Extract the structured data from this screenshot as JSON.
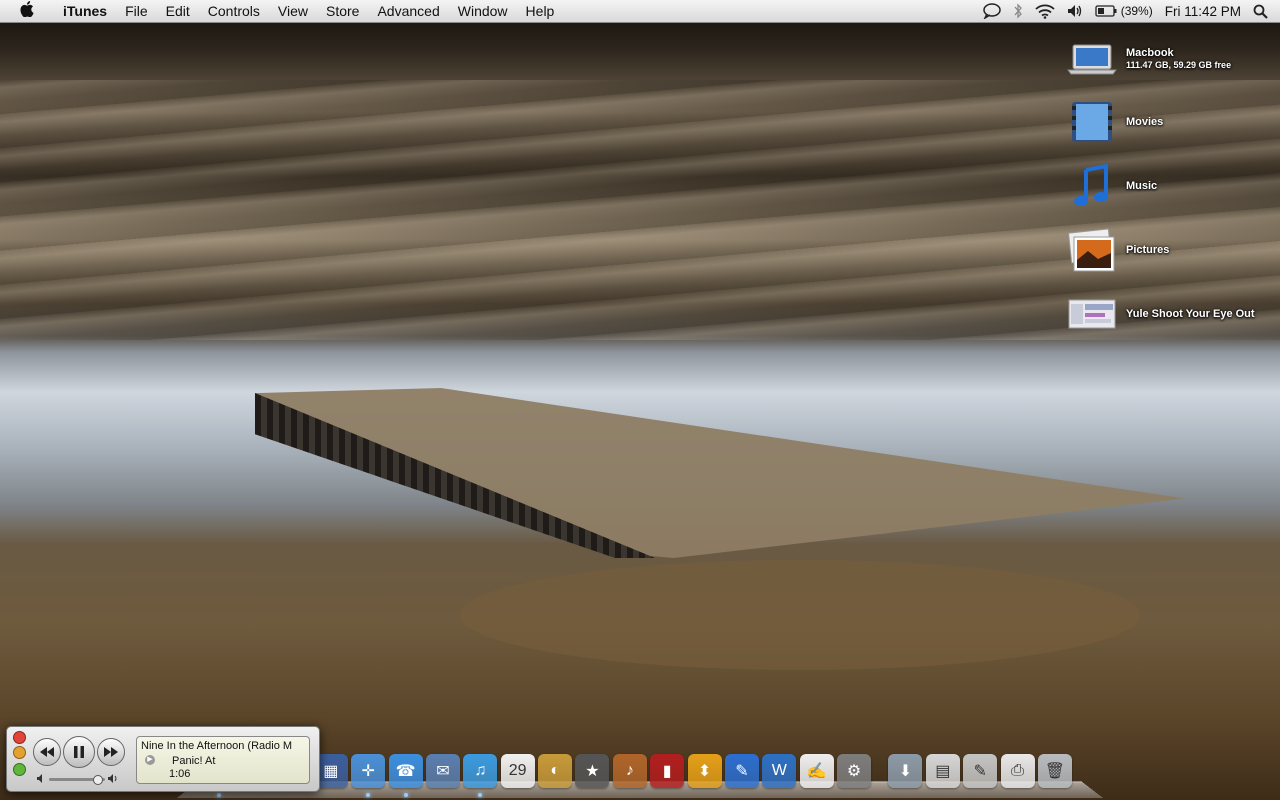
{
  "menubar": {
    "apple_icon": "apple-icon",
    "app_name": "iTunes",
    "menus": [
      "File",
      "Edit",
      "Controls",
      "View",
      "Store",
      "Advanced",
      "Window",
      "Help"
    ],
    "status": {
      "icons": [
        "ichat-icon",
        "bluetooth-icon",
        "wifi-icon",
        "volume-icon",
        "battery-icon",
        "spotlight-icon"
      ],
      "battery": "(39%)",
      "clock": "Fri 11:42 PM"
    }
  },
  "desktop_icons": [
    {
      "label": "Macbook",
      "sub": "111.47 GB, 59.29 GB free",
      "icon": "macbook-drive-icon"
    },
    {
      "label": "Movies",
      "icon": "movies-folder-icon"
    },
    {
      "label": "Music",
      "icon": "music-folder-icon"
    },
    {
      "label": "Pictures",
      "icon": "pictures-folder-icon"
    },
    {
      "label": "Yule Shoot Your Eye Out",
      "icon": "document-thumbnail-icon"
    }
  ],
  "mini_player": {
    "track": "Nine In the Afternoon (Radio M",
    "artist": "Panic! At the Disco",
    "artist_visible": "Panic! At",
    "time": "1:06",
    "controls": [
      "previous-button",
      "pause-button",
      "next-button"
    ],
    "volume_level": 0.85
  },
  "dock": {
    "apps": [
      {
        "name": "finder-icon",
        "running": true,
        "color": "#3d7fd6",
        "glyph": "☺"
      },
      {
        "name": "dashboard-icon",
        "running": false,
        "color": "#2a2a2a",
        "glyph": "◉"
      },
      {
        "name": "front-row-icon",
        "running": false,
        "color": "#1f5a2a",
        "glyph": "▣"
      },
      {
        "name": "spaces-icon",
        "running": false,
        "color": "#3b5f9e",
        "glyph": "▦"
      },
      {
        "name": "safari-icon",
        "running": true,
        "color": "#4a90d9",
        "glyph": "✛"
      },
      {
        "name": "ichat-icon",
        "running": true,
        "color": "#3c8fe0",
        "glyph": "☎"
      },
      {
        "name": "mail-icon",
        "running": false,
        "color": "#5a7fb0",
        "glyph": "✉"
      },
      {
        "name": "itunes-icon",
        "running": true,
        "color": "#3b9be0",
        "glyph": "♫"
      },
      {
        "name": "ical-icon",
        "running": false,
        "color": "#f0f0f0",
        "glyph": "29"
      },
      {
        "name": "iphoto-icon",
        "running": false,
        "color": "#c79a3a",
        "glyph": "◐"
      },
      {
        "name": "imovie-icon",
        "running": false,
        "color": "#555555",
        "glyph": "★"
      },
      {
        "name": "garageband-icon",
        "running": false,
        "color": "#b0652a",
        "glyph": "♪"
      },
      {
        "name": "photo-booth-icon",
        "running": false,
        "color": "#b21e1e",
        "glyph": "▮"
      },
      {
        "name": "transmit-icon",
        "running": false,
        "color": "#e5a018",
        "glyph": "⬍"
      },
      {
        "name": "quill-icon",
        "running": false,
        "color": "#2b6fd0",
        "glyph": "✎"
      },
      {
        "name": "word-icon",
        "running": false,
        "color": "#2d70c4",
        "glyph": "W"
      },
      {
        "name": "textedit-icon",
        "running": false,
        "color": "#eeeeee",
        "glyph": "✍"
      },
      {
        "name": "system-preferences-icon",
        "running": false,
        "color": "#7d7d7d",
        "glyph": "⚙"
      }
    ],
    "stacks": [
      {
        "name": "downloads-stack-icon",
        "color": "#8c9aa8",
        "glyph": "⬇"
      },
      {
        "name": "documents-stack-icon",
        "color": "#d6d6d6",
        "glyph": "▤"
      },
      {
        "name": "applications-stack-icon",
        "color": "#c4c4c4",
        "glyph": "✎"
      },
      {
        "name": "printer-icon",
        "color": "#e8e8e8",
        "glyph": "⎙"
      },
      {
        "name": "trash-icon",
        "color": "#b8bcc0",
        "glyph": "🗑"
      }
    ]
  }
}
